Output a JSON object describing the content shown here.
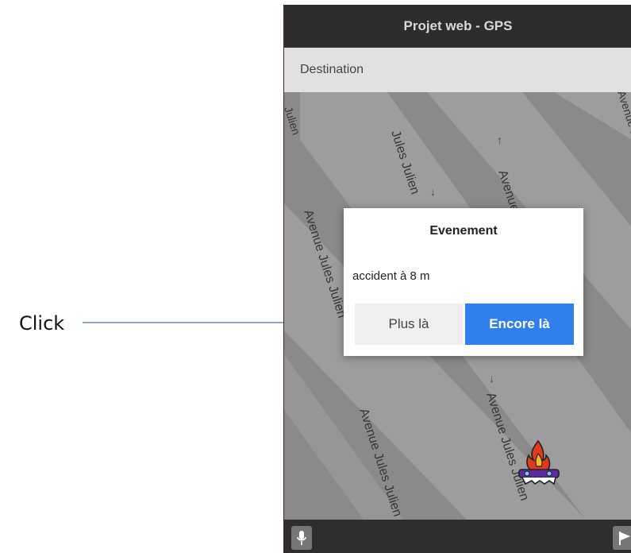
{
  "annotation": {
    "label": "Click"
  },
  "app": {
    "title": "Projet web - GPS",
    "destination_placeholder": "Destination"
  },
  "map": {
    "street_labels": [
      "Jules Julien",
      "Avenue Jules Julien",
      "Avenue Jules Julien",
      "Avenue Jules Julien",
      "Avenue Jules Julien",
      "Julien",
      "Avenue Jules Julien"
    ]
  },
  "dialog": {
    "title": "Evenement",
    "message": "accident à 8 m",
    "no_button": "Plus là",
    "yes_button": "Encore là"
  },
  "icons": {
    "mic": "microphone-icon",
    "flag": "flag-icon",
    "event": "car-fire-icon"
  },
  "colors": {
    "primary": "#2f80ed",
    "header": "#2d2d2d",
    "annotation_arrow": "#4472c4"
  }
}
